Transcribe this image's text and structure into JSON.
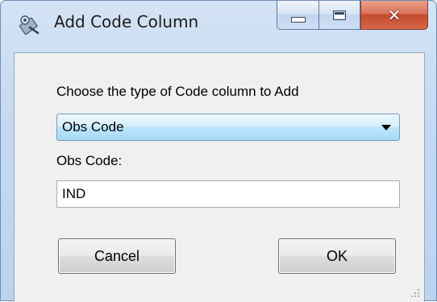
{
  "window": {
    "title": "Add Code Column",
    "icon": "tool-icon",
    "controls": [
      "minimize-icon",
      "maximize-icon",
      "close-icon"
    ],
    "close_glyph": "✕",
    "accent_close": "#c44a2b"
  },
  "form": {
    "type_label": "Choose the type of Code column to Add",
    "type_select": {
      "selected": "Obs Code"
    },
    "code_label": "Obs Code:",
    "code_value": "IND"
  },
  "buttons": {
    "cancel_label": "Cancel",
    "ok_label": "OK"
  }
}
